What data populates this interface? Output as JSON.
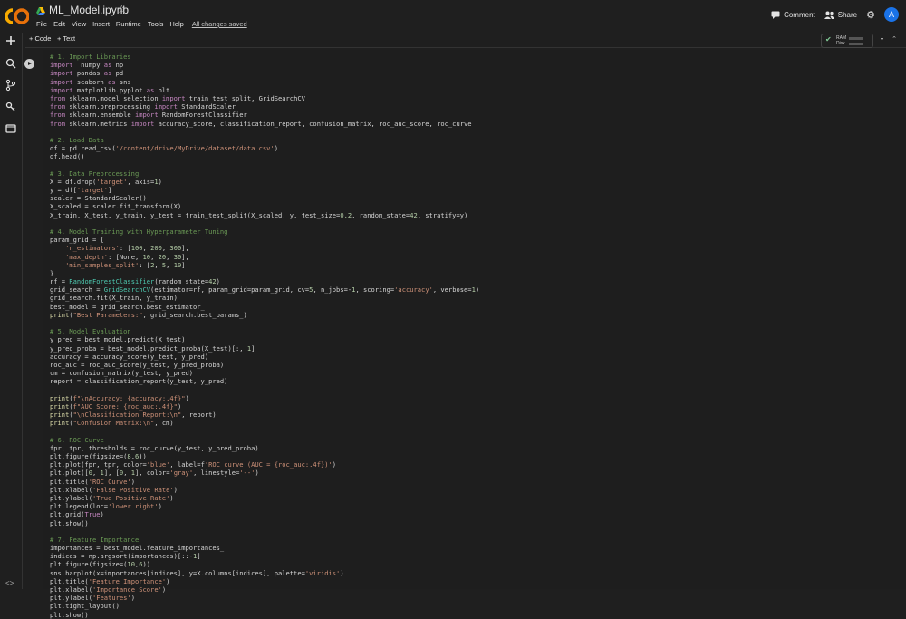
{
  "header": {
    "title": "ML_Model.ipynb",
    "menu": [
      "File",
      "Edit",
      "View",
      "Insert",
      "Runtime",
      "Tools",
      "Help"
    ],
    "saved_status": "All changes saved",
    "comment_label": "Comment",
    "share_label": "Share",
    "avatar_letter": "A"
  },
  "toolbar": {
    "add_code": "+ Code",
    "add_text": "+ Text",
    "ram_label": "RAM",
    "disk_label": "Disk"
  },
  "colors": {
    "accent": "#1a73e8",
    "logo_orange": "#f9ab00"
  },
  "code_lines": [
    [
      [
        "cm",
        "# 1. Import Libraries"
      ]
    ],
    [
      [
        "kw",
        "import"
      ],
      [
        "",
        "  numpy "
      ],
      [
        "kw",
        "as"
      ],
      [
        "",
        " np"
      ]
    ],
    [
      [
        "kw",
        "import"
      ],
      [
        "",
        " pandas "
      ],
      [
        "kw",
        "as"
      ],
      [
        "",
        " pd"
      ]
    ],
    [
      [
        "kw",
        "import"
      ],
      [
        "",
        " seaborn "
      ],
      [
        "kw",
        "as"
      ],
      [
        "",
        " sns"
      ]
    ],
    [
      [
        "kw",
        "import"
      ],
      [
        "",
        " matplotlib.pyplot "
      ],
      [
        "kw",
        "as"
      ],
      [
        "",
        " plt"
      ]
    ],
    [
      [
        "kw",
        "from"
      ],
      [
        "",
        " sklearn.model_selection "
      ],
      [
        "kw",
        "import"
      ],
      [
        "",
        " train_test_split, GridSearchCV"
      ]
    ],
    [
      [
        "kw",
        "from"
      ],
      [
        "",
        " sklearn.preprocessing "
      ],
      [
        "kw",
        "import"
      ],
      [
        "",
        " StandardScaler"
      ]
    ],
    [
      [
        "kw",
        "from"
      ],
      [
        "",
        " sklearn.ensemble "
      ],
      [
        "kw",
        "import"
      ],
      [
        "",
        " RandomForestClassifier"
      ]
    ],
    [
      [
        "kw",
        "from"
      ],
      [
        "",
        " sklearn.metrics "
      ],
      [
        "kw",
        "import"
      ],
      [
        "",
        " accuracy_score, classification_report, confusion_matrix, roc_auc_score, roc_curve"
      ]
    ],
    [],
    [
      [
        "cm",
        "# 2. Load Data"
      ]
    ],
    [
      [
        "",
        "df = pd.read_csv("
      ],
      [
        "st",
        "'/content/drive/MyDrive/dataset/data.csv'"
      ],
      [
        "",
        ")"
      ]
    ],
    [
      [
        "",
        "df.head()"
      ]
    ],
    [],
    [
      [
        "cm",
        "# 3. Data Preprocessing"
      ]
    ],
    [
      [
        "",
        "X = df.drop("
      ],
      [
        "st",
        "'target'"
      ],
      [
        "",
        ", axis="
      ],
      [
        "nm",
        "1"
      ],
      [
        "",
        ")"
      ]
    ],
    [
      [
        "",
        "y = df["
      ],
      [
        "st",
        "'target'"
      ],
      [
        "",
        "]"
      ]
    ],
    [
      [
        "",
        "scaler = StandardScaler()"
      ]
    ],
    [
      [
        "",
        "X_scaled = scaler.fit_transform(X)"
      ]
    ],
    [
      [
        "",
        "X_train, X_test, y_train, y_test = train_test_split(X_scaled, y, test_size="
      ],
      [
        "nm",
        "0.2"
      ],
      [
        "",
        ", random_state="
      ],
      [
        "nm",
        "42"
      ],
      [
        "",
        ", stratify=y)"
      ]
    ],
    [],
    [
      [
        "cm",
        "# 4. Model Training with Hyperparameter Tuning"
      ]
    ],
    [
      [
        "",
        "param_grid = {"
      ]
    ],
    [
      [
        "",
        "    "
      ],
      [
        "st",
        "'n_estimators'"
      ],
      [
        "",
        ": ["
      ],
      [
        "nm",
        "100"
      ],
      [
        "",
        ", "
      ],
      [
        "nm",
        "200"
      ],
      [
        "",
        ", "
      ],
      [
        "nm",
        "300"
      ],
      [
        "",
        "],"
      ]
    ],
    [
      [
        "",
        "    "
      ],
      [
        "st",
        "'max_depth'"
      ],
      [
        "",
        ": [None, "
      ],
      [
        "nm",
        "10"
      ],
      [
        "",
        ", "
      ],
      [
        "nm",
        "20"
      ],
      [
        "",
        ", "
      ],
      [
        "nm",
        "30"
      ],
      [
        "",
        "],"
      ]
    ],
    [
      [
        "",
        "    "
      ],
      [
        "st",
        "'min_samples_split'"
      ],
      [
        "",
        ": ["
      ],
      [
        "nm",
        "2"
      ],
      [
        "",
        ", "
      ],
      [
        "nm",
        "5"
      ],
      [
        "",
        ", "
      ],
      [
        "nm",
        "10"
      ],
      [
        "",
        "]"
      ]
    ],
    [
      [
        "",
        "}"
      ]
    ],
    [
      [
        "",
        "rf = "
      ],
      [
        "cls",
        "RandomForestClassifier"
      ],
      [
        "",
        "(random_state="
      ],
      [
        "nm",
        "42"
      ],
      [
        "",
        ")"
      ]
    ],
    [
      [
        "",
        "grid_search = "
      ],
      [
        "cls",
        "GridSearchCV"
      ],
      [
        "",
        "(estimator=rf, param_grid=param_grid, cv="
      ],
      [
        "nm",
        "5"
      ],
      [
        "",
        ", n_jobs=-"
      ],
      [
        "nm",
        "1"
      ],
      [
        "",
        ", scoring="
      ],
      [
        "st",
        "'accuracy'"
      ],
      [
        "",
        ", verbose="
      ],
      [
        "nm",
        "1"
      ],
      [
        "",
        ")"
      ]
    ],
    [
      [
        "",
        "grid_search.fit(X_train, y_train)"
      ]
    ],
    [
      [
        "",
        "best_model = grid_search.best_estimator_"
      ]
    ],
    [
      [
        "fn",
        "print"
      ],
      [
        "",
        "("
      ],
      [
        "st",
        "\"Best Parameters:\""
      ],
      [
        "",
        ", grid_search.best_params_)"
      ]
    ],
    [],
    [
      [
        "cm",
        "# 5. Model Evaluation"
      ]
    ],
    [
      [
        "",
        "y_pred = best_model.predict(X_test)"
      ]
    ],
    [
      [
        "",
        "y_pred_proba = best_model.predict_proba(X_test)[:, "
      ],
      [
        "nm",
        "1"
      ],
      [
        "",
        "]"
      ]
    ],
    [
      [
        "",
        "accuracy = accuracy_score(y_test, y_pred)"
      ]
    ],
    [
      [
        "",
        "roc_auc = roc_auc_score(y_test, y_pred_proba)"
      ]
    ],
    [
      [
        "",
        "cm = confusion_matrix(y_test, y_pred)"
      ]
    ],
    [
      [
        "",
        "report = classification_report(y_test, y_pred)"
      ]
    ],
    [],
    [
      [
        "fn",
        "print"
      ],
      [
        "",
        "("
      ],
      [
        "st",
        "f\"\\nAccuracy: {accuracy:.4f}\""
      ],
      [
        "",
        ")"
      ]
    ],
    [
      [
        "fn",
        "print"
      ],
      [
        "",
        "("
      ],
      [
        "st",
        "f\"AUC Score: {roc_auc:.4f}\""
      ],
      [
        "",
        ")"
      ]
    ],
    [
      [
        "fn",
        "print"
      ],
      [
        "",
        "("
      ],
      [
        "st",
        "\"\\nClassification Report:\\n\""
      ],
      [
        "",
        ", report)"
      ]
    ],
    [
      [
        "fn",
        "print"
      ],
      [
        "",
        "("
      ],
      [
        "st",
        "\"Confusion Matrix:\\n\""
      ],
      [
        "",
        ", cm)"
      ]
    ],
    [],
    [
      [
        "cm",
        "# 6. ROC Curve"
      ]
    ],
    [
      [
        "",
        "fpr, tpr, thresholds = roc_curve(y_test, y_pred_proba)"
      ]
    ],
    [
      [
        "",
        "plt.figure(figsize=("
      ],
      [
        "nm",
        "8"
      ],
      [
        "",
        ","
      ],
      [
        "nm",
        "6"
      ],
      [
        "",
        "))"
      ]
    ],
    [
      [
        "",
        "plt.plot(fpr, tpr, color="
      ],
      [
        "st",
        "'blue'"
      ],
      [
        "",
        ", label=f"
      ],
      [
        "st",
        "'ROC curve (AUC = {roc_auc:.4f})'"
      ],
      [
        "",
        ")"
      ]
    ],
    [
      [
        "",
        "plt.plot(["
      ],
      [
        "nm",
        "0"
      ],
      [
        "",
        ", "
      ],
      [
        "nm",
        "1"
      ],
      [
        "",
        "], ["
      ],
      [
        "nm",
        "0"
      ],
      [
        "",
        ", "
      ],
      [
        "nm",
        "1"
      ],
      [
        "",
        "], color="
      ],
      [
        "st",
        "'gray'"
      ],
      [
        "",
        ", linestyle="
      ],
      [
        "st",
        "'--'"
      ],
      [
        "",
        ")"
      ]
    ],
    [
      [
        "",
        "plt.title("
      ],
      [
        "st",
        "'ROC Curve'"
      ],
      [
        "",
        ")"
      ]
    ],
    [
      [
        "",
        "plt.xlabel("
      ],
      [
        "st",
        "'False Positive Rate'"
      ],
      [
        "",
        ")"
      ]
    ],
    [
      [
        "",
        "plt.ylabel("
      ],
      [
        "st",
        "'True Positive Rate'"
      ],
      [
        "",
        ")"
      ]
    ],
    [
      [
        "",
        "plt.legend(loc="
      ],
      [
        "st",
        "'lower right'"
      ],
      [
        "",
        ")"
      ]
    ],
    [
      [
        "",
        "plt.grid("
      ],
      [
        "kw",
        "True"
      ],
      [
        "",
        ")"
      ]
    ],
    [
      [
        "",
        "plt.show()"
      ]
    ],
    [],
    [
      [
        "cm",
        "# 7. Feature Importance"
      ]
    ],
    [
      [
        "",
        "importances = best_model.feature_importances_"
      ]
    ],
    [
      [
        "",
        "indices = np.argsort(importances)[::-"
      ],
      [
        "nm",
        "1"
      ],
      [
        "",
        "]"
      ]
    ],
    [
      [
        "",
        "plt.figure(figsize=("
      ],
      [
        "nm",
        "10"
      ],
      [
        "",
        ","
      ],
      [
        "nm",
        "6"
      ],
      [
        "",
        "))"
      ]
    ],
    [
      [
        "",
        "sns.barplot(x=importances[indices], y=X.columns[indices], palette="
      ],
      [
        "st",
        "'viridis'"
      ],
      [
        "",
        ")"
      ]
    ],
    [
      [
        "",
        "plt.title("
      ],
      [
        "st",
        "'Feature Importance'"
      ],
      [
        "",
        ")"
      ]
    ],
    [
      [
        "",
        "plt.xlabel("
      ],
      [
        "st",
        "'Importance Score'"
      ],
      [
        "",
        ")"
      ]
    ],
    [
      [
        "",
        "plt.ylabel("
      ],
      [
        "st",
        "'Features'"
      ],
      [
        "",
        ")"
      ]
    ],
    [
      [
        "",
        "plt.tight_layout()"
      ]
    ],
    [
      [
        "",
        "plt.show()"
      ]
    ]
  ]
}
